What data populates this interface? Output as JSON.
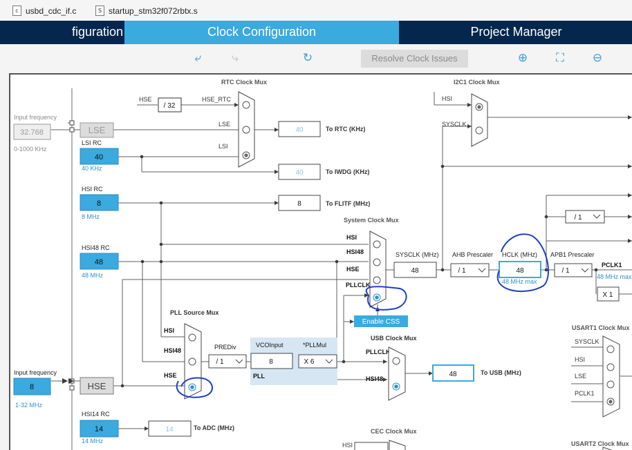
{
  "file_tabs": [
    {
      "icon": "c",
      "label": "usbd_cdc_if.c"
    },
    {
      "icon": "S",
      "label": "startup_stm32f072rbtx.s"
    }
  ],
  "nav_tabs": {
    "pinout": "figuration",
    "clock": "Clock Configuration",
    "project": "Project Manager"
  },
  "toolbar": {
    "undo_icon": "undo-icon",
    "redo_icon": "redo-icon",
    "refresh_icon": "refresh-icon",
    "resolve_label": "Resolve Clock Issues",
    "zoom_in_icon": "zoom-in-icon",
    "fit_icon": "fit-screen-icon",
    "zoom_out_icon": "zoom-out-icon"
  },
  "diagram": {
    "lse": {
      "input_label": "Input frequency",
      "value": "32.768",
      "range": "0-1000 KHz",
      "name": "LSE"
    },
    "lsi": {
      "label": "LSI RC",
      "value": "40",
      "unit": "40 KHz"
    },
    "hsi": {
      "label": "HSI RC",
      "value": "8",
      "unit": "8 MHz"
    },
    "hsi48": {
      "label": "HSI48 RC",
      "value": "48",
      "unit": "48 MHz"
    },
    "hse": {
      "input_label": "Input frequency",
      "value": "8",
      "range": "1-32 MHz",
      "name": "HSE"
    },
    "hsi14": {
      "label": "HSI14 RC",
      "value": "14",
      "unit": "14 MHz"
    },
    "rtc_mux": {
      "title": "RTC Clock Mux",
      "in_hse": "HSE",
      "div": "/ 32",
      "hse_rtc": "HSE_RTC",
      "in_lse": "LSE",
      "in_lsi": "LSI"
    },
    "rtc_out": {
      "value": "40",
      "label": "To RTC (KHz)"
    },
    "iwdg_out": {
      "value": "40",
      "label": "To IWDG (KHz)"
    },
    "flitf_out": {
      "value": "8",
      "label": "To FLITF (MHz)"
    },
    "adc_out": {
      "value": "14",
      "label": "To ADC (MHz)"
    },
    "sys_mux": {
      "title": "System Clock Mux",
      "in_hsi": "HSI",
      "in_hsi48": "HSI48",
      "in_hse": "HSE",
      "in_pll": "PLLCLK"
    },
    "enable_css": "Enable CSS",
    "sysclk": {
      "label": "SYSCLK (MHz)",
      "value": "48"
    },
    "ahb": {
      "label": "AHB Prescaler",
      "value": "/ 1"
    },
    "hclk": {
      "label": "HCLK (MHz)",
      "value": "48",
      "max": "48 MHz max"
    },
    "apb1": {
      "label": "APB1 Prescaler",
      "value": "/ 1"
    },
    "pclk1": {
      "label": "PCLK1",
      "max": "48 MHz max"
    },
    "x1": "X 1",
    "right_div": "/ 1",
    "pll_mux": {
      "title": "PLL Source Mux",
      "in_hsi": "HSI",
      "in_hsi48": "HSI48",
      "in_hse": "HSE"
    },
    "prediv": {
      "label": "PREDiv",
      "value": "/ 1"
    },
    "vco": {
      "label": "VCOInput",
      "value": "8"
    },
    "pllmul": {
      "label": "*PLLMul",
      "value": "X 6"
    },
    "pll_label": "PLL",
    "usb_mux": {
      "title": "USB Clock Mux",
      "in_pll": "PLLCLK",
      "in_hsi48": "HSI48"
    },
    "usb_out": {
      "value": "48",
      "label": "To USB (MHz)"
    },
    "i2c1_mux": {
      "title": "I2C1 Clock Mux",
      "in_hsi": "HSI",
      "in_sysclk": "SYSCLK"
    },
    "usart1_mux": {
      "title": "USART1 Clock Mux",
      "in_sysclk": "SYSCLK",
      "in_hsi": "HSI",
      "in_lse": "LSE",
      "in_pclk1": "PCLK1"
    },
    "cec_mux": {
      "title": "CEC Clock Mux",
      "in_hsi": "HSI"
    },
    "usart2_mux": {
      "title": "USART2 Clock Mux"
    }
  },
  "colors": {
    "navbar": "#05264d",
    "active_tab": "#3aaadf",
    "source_fill": "#3aaadf",
    "wire": "#5f5f5f",
    "pen": "#1f3ec9"
  }
}
